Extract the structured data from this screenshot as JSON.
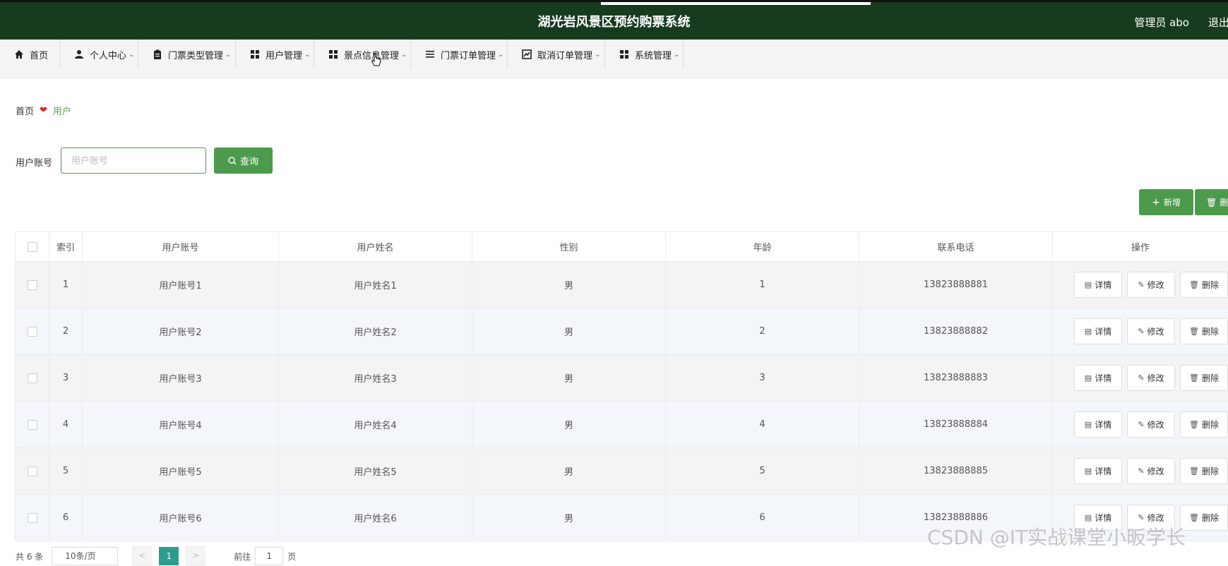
{
  "header": {
    "title": "湖光岩风景区预约购票系统",
    "user": "管理员 abo",
    "logout": "退出"
  },
  "nav": [
    {
      "label": "首页",
      "icon": "home-icon",
      "chev": false
    },
    {
      "label": "个人中心",
      "icon": "user-icon",
      "chev": true
    },
    {
      "label": "门票类型管理",
      "icon": "clipboard-icon",
      "chev": true
    },
    {
      "label": "用户管理",
      "icon": "grid-icon",
      "chev": true
    },
    {
      "label": "景点信息管理",
      "icon": "grid-icon",
      "chev": true
    },
    {
      "label": "门票订单管理",
      "icon": "list-icon",
      "chev": true
    },
    {
      "label": "取消订单管理",
      "icon": "chart-icon",
      "chev": true
    },
    {
      "label": "系统管理",
      "icon": "grid-icon",
      "chev": true
    }
  ],
  "breadcrumb": {
    "home": "首页",
    "current": "用户"
  },
  "search": {
    "label": "用户账号",
    "placeholder": "用户账号",
    "button": "查询"
  },
  "actions": {
    "add": "新增",
    "delete": "删除"
  },
  "table": {
    "headers": [
      "索引",
      "用户账号",
      "用户姓名",
      "性别",
      "年龄",
      "联系电话",
      "操作"
    ],
    "rows": [
      {
        "index": "1",
        "account": "用户账号1",
        "name": "用户姓名1",
        "gender": "男",
        "age": "1",
        "phone": "13823888881"
      },
      {
        "index": "2",
        "account": "用户账号2",
        "name": "用户姓名2",
        "gender": "男",
        "age": "2",
        "phone": "13823888882"
      },
      {
        "index": "3",
        "account": "用户账号3",
        "name": "用户姓名3",
        "gender": "男",
        "age": "3",
        "phone": "13823888883"
      },
      {
        "index": "4",
        "account": "用户账号4",
        "name": "用户姓名4",
        "gender": "男",
        "age": "4",
        "phone": "13823888884"
      },
      {
        "index": "5",
        "account": "用户账号5",
        "name": "用户姓名5",
        "gender": "男",
        "age": "5",
        "phone": "13823888885"
      },
      {
        "index": "6",
        "account": "用户账号6",
        "name": "用户姓名6",
        "gender": "男",
        "age": "6",
        "phone": "13823888886"
      }
    ],
    "row_actions": {
      "detail": "详情",
      "edit": "修改",
      "delete": "删除"
    }
  },
  "pagination": {
    "total": "共 6 条",
    "page_size": "10条/页",
    "prev": "<",
    "current": "1",
    "next": ">",
    "goto": "前往",
    "goto_value": "1",
    "page_unit": "页"
  },
  "watermark": "CSDN @IT实战课堂小昄学长"
}
